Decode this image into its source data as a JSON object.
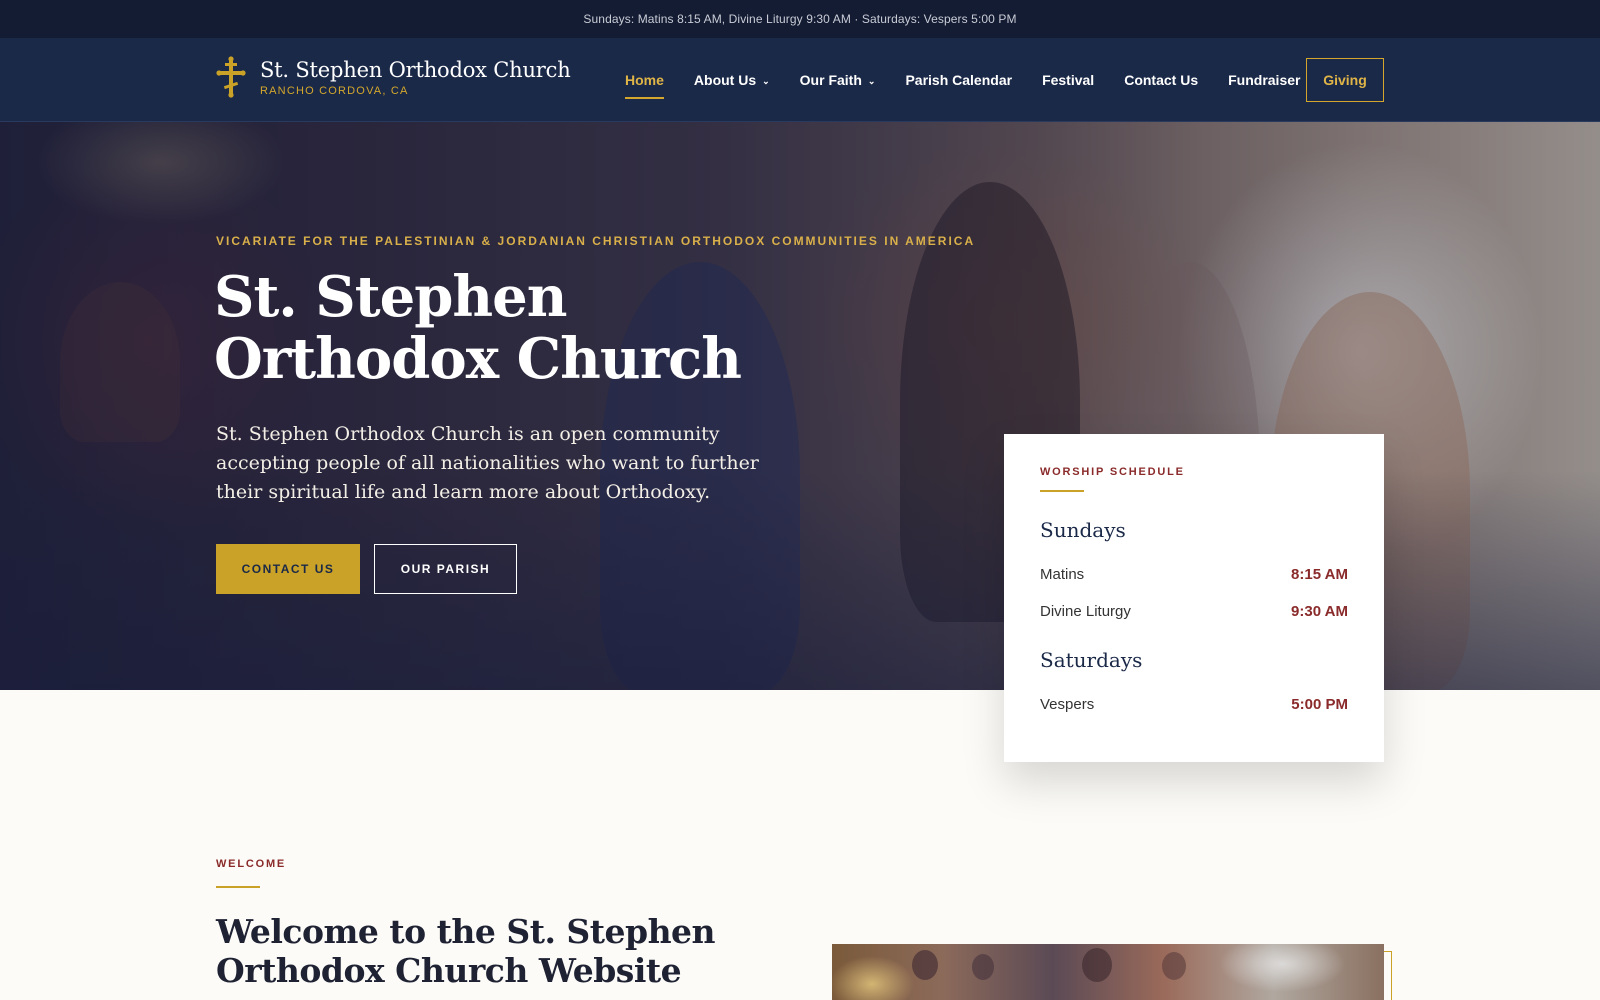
{
  "topbar": {
    "text": "Sundays: Matins 8:15 AM, Divine Liturgy 9:30 AM · Saturdays: Vespers 5:00 PM"
  },
  "brand": {
    "name": "St. Stephen Orthodox Church",
    "location": "RANCHO CORDOVA, CA",
    "icon": "orthodox-cross-icon"
  },
  "nav": {
    "items": [
      {
        "label": "Home",
        "active": true
      },
      {
        "label": "About Us",
        "dropdown": true
      },
      {
        "label": "Our Faith",
        "dropdown": true
      },
      {
        "label": "Parish Calendar"
      },
      {
        "label": "Festival"
      },
      {
        "label": "Contact Us"
      },
      {
        "label": "Fundraiser"
      }
    ],
    "cta": "Giving"
  },
  "hero": {
    "eyebrow": "VICARIATE FOR THE PALESTINIAN & JORDANIAN CHRISTIAN ORTHODOX COMMUNITIES IN AMERICA",
    "title": "St. Stephen Orthodox Church",
    "description": "St. Stephen Orthodox Church is an open community accepting people of all nationalities who want to further their spiritual life and learn more about Orthodoxy.",
    "primary_button": "CONTACT US",
    "secondary_button": "OUR PARISH"
  },
  "schedule": {
    "eyebrow": "WORSHIP SCHEDULE",
    "days": [
      {
        "name": "Sundays",
        "services": [
          {
            "label": "Matins",
            "time": "8:15 AM"
          },
          {
            "label": "Divine Liturgy",
            "time": "9:30 AM"
          }
        ]
      },
      {
        "name": "Saturdays",
        "services": [
          {
            "label": "Vespers",
            "time": "5:00 PM"
          }
        ]
      }
    ]
  },
  "welcome": {
    "eyebrow": "WELCOME",
    "title": "Welcome to the St. Stephen Orthodox Church Website"
  },
  "colors": {
    "navy": "#1b2948",
    "topbar": "#141c33",
    "gold": "#c9a227",
    "maroon": "#8a2a2a",
    "cream": "#fcfbf7"
  }
}
